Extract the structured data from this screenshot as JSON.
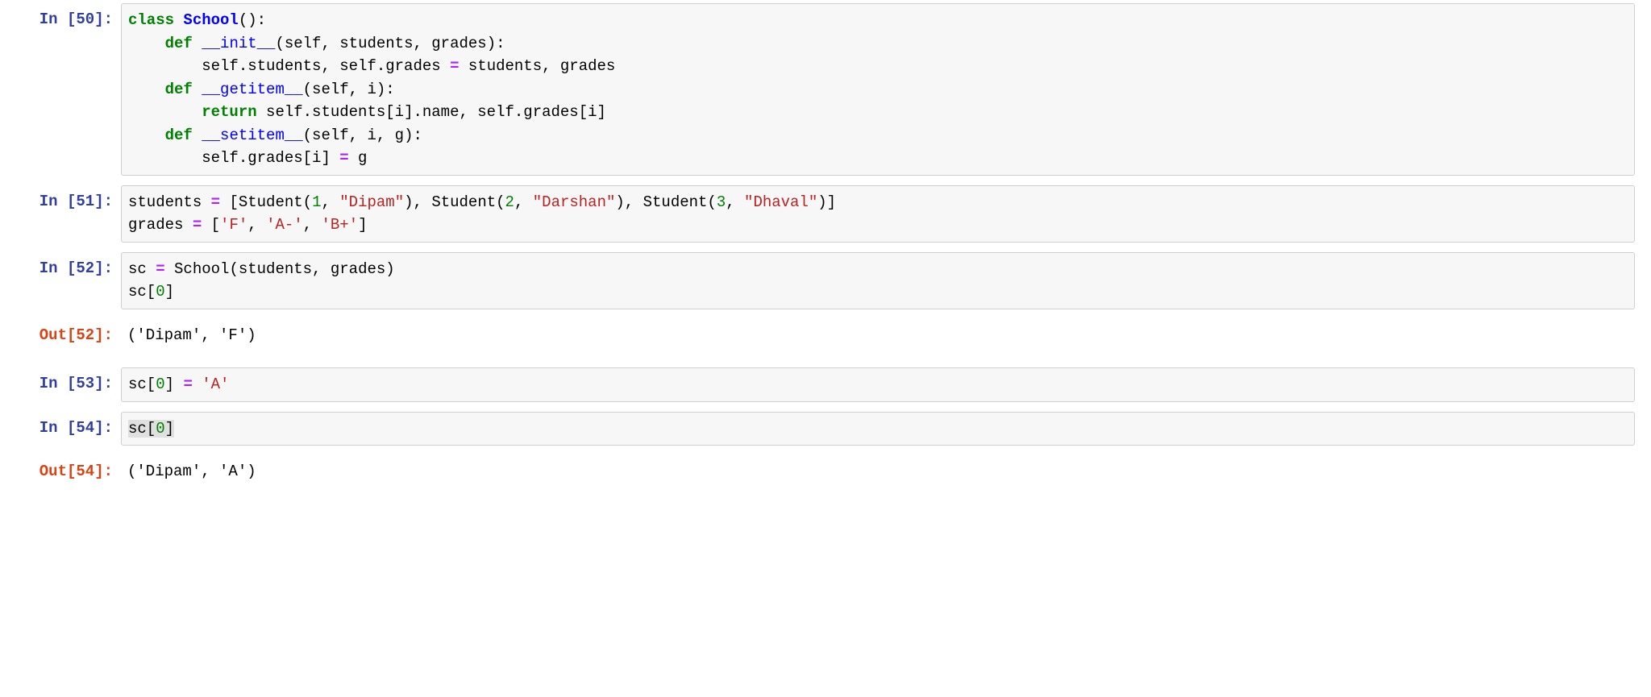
{
  "cells": [
    {
      "prompt_in": "In [50]:",
      "tokens50": {
        "class": "class",
        "school": "School",
        "paren_open": "()",
        "colon": ":",
        "indent1": "    ",
        "indent2": "        ",
        "def": "def",
        "init": "__init__",
        "init_args": "(self, students, grades):",
        "line2": "self.students, self.grades ",
        "eq": "=",
        "line2b": " students, grades",
        "getitem": "__getitem__",
        "getitem_args": "(self, i):",
        "return": "return",
        "line4": " self.students[i].name, self.grades[i]",
        "setitem": "__setitem__",
        "setitem_args": "(self, i, g):",
        "line6a": "self.grades[i] ",
        "line6b": " g"
      }
    },
    {
      "prompt_in": "In [51]:",
      "tokens51": {
        "students": "students ",
        "eq": "=",
        "sp": " ",
        "lbr": "[",
        "student": "Student(",
        "n1": "1",
        "comma": ", ",
        "dipam": "\"Dipam\"",
        "rp": ")",
        "n2": "2",
        "darshan": "\"Darshan\"",
        "n3": "3",
        "dhaval": "\"Dhaval\"",
        "rbr": "]",
        "grades": "grades ",
        "f": "'F'",
        "aminus": "'A-'",
        "bplus": "'B+'"
      }
    },
    {
      "prompt_in": "In [52]:",
      "tokens52": {
        "sc": "sc ",
        "eq": "=",
        "school": " School(students, grades)",
        "line2a": "sc[",
        "zero": "0",
        "line2b": "]"
      },
      "prompt_out": "Out[52]:",
      "output": "('Dipam', 'F')"
    },
    {
      "prompt_in": "In [53]:",
      "tokens53": {
        "a": "sc[",
        "zero": "0",
        "b": "] ",
        "eq": "=",
        "sp": " ",
        "astr": "'A'"
      }
    },
    {
      "prompt_in": "In [54]:",
      "tokens54": {
        "a": "sc[",
        "zero": "0",
        "b": "]"
      },
      "prompt_out": "Out[54]:",
      "output": "('Dipam', 'A')"
    }
  ]
}
